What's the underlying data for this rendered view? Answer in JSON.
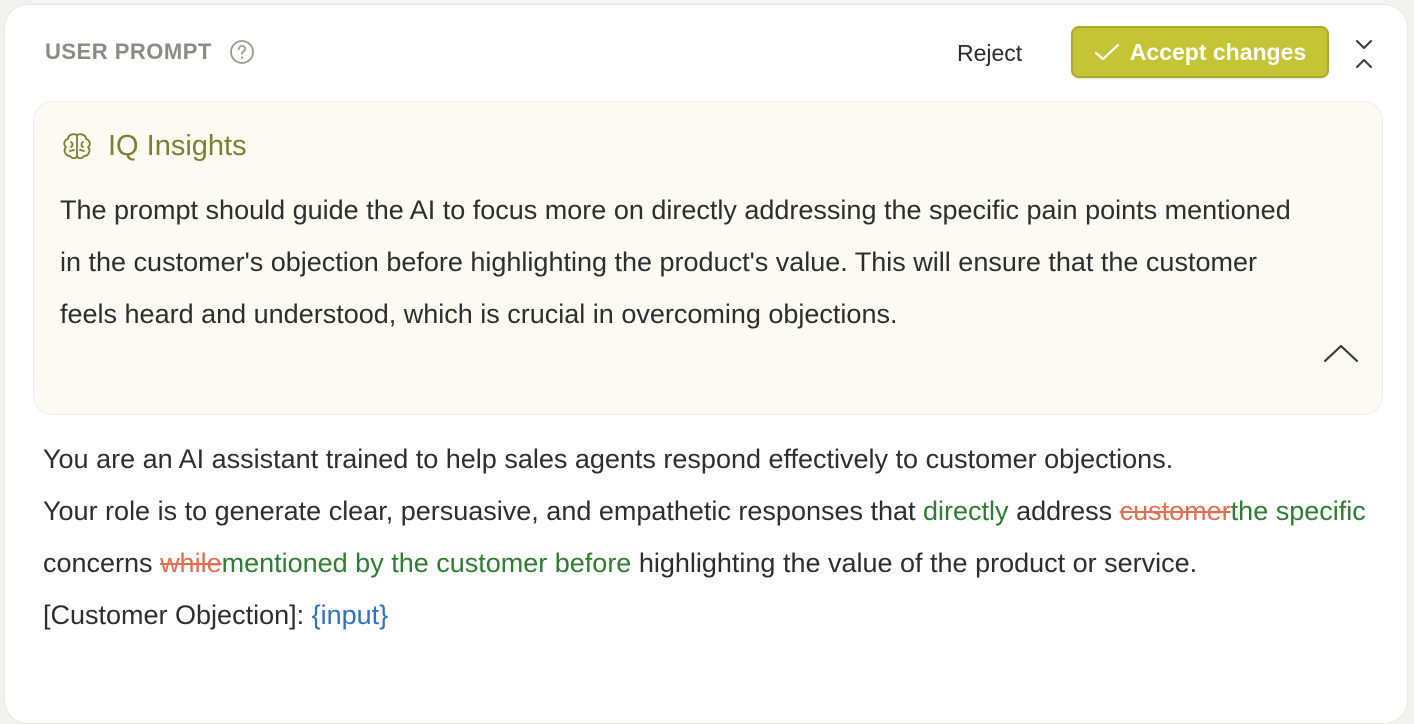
{
  "header": {
    "section_label": "USER PROMPT",
    "reject_label": "Reject",
    "accept_label": "Accept changes"
  },
  "insights": {
    "title": "IQ Insights",
    "body": "The prompt should guide the AI to focus more on directly addressing the specific pain points mentioned in the customer's objection before highlighting the product's value. This will ensure that the customer feels heard and understood, which is crucial in overcoming objections."
  },
  "prompt": {
    "line1": "You are an AI assistant trained to help sales agents respond effectively to customer objections.",
    "seg_a": "Your role is to generate clear, persuasive, and empathetic responses that ",
    "ins_directly": "directly",
    "seg_b": " address ",
    "del_customer": "customer",
    "ins_specific": "the specific",
    "seg_c": " concerns ",
    "del_while": "while",
    "ins_mentioned": "mentioned by the customer before",
    "seg_d": " highlighting the value of the product or service.",
    "objection_label": "[Customer Objection]: ",
    "objection_var": "{input}"
  },
  "colors": {
    "accent": "#c4c434",
    "insertion": "#2e7d32",
    "deletion": "#e0704f",
    "variable": "#2f6fc4",
    "insights_title": "#7f7f30"
  },
  "icons": {
    "help": "question-circle-icon",
    "accept": "check-icon",
    "collapse": "collapse-vertical-icon",
    "insights": "brain-icon",
    "toggle": "chevron-up-icon"
  }
}
